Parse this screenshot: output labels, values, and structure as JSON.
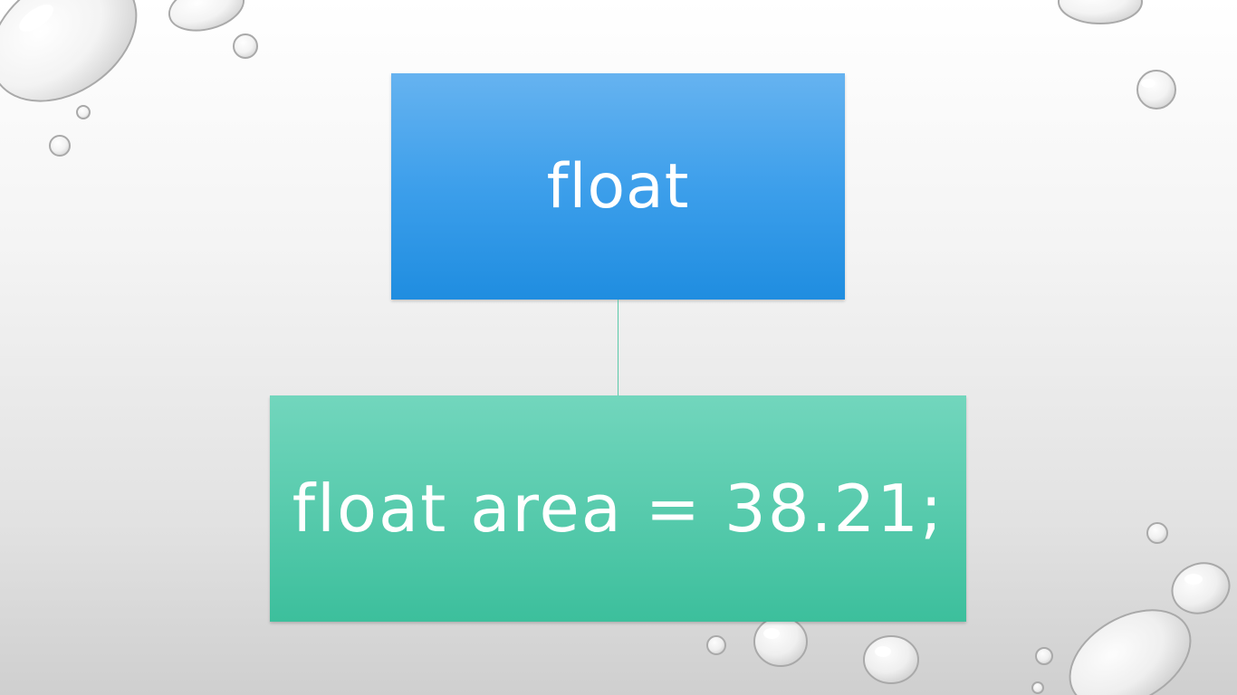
{
  "slide": {
    "nodes": [
      {
        "label": "float",
        "color": "#3d9feb"
      },
      {
        "label": "float area = 38.21;",
        "color": "#4fc6a6"
      }
    ],
    "connector_color": "#5bc9a9",
    "background": "water-droplets"
  }
}
